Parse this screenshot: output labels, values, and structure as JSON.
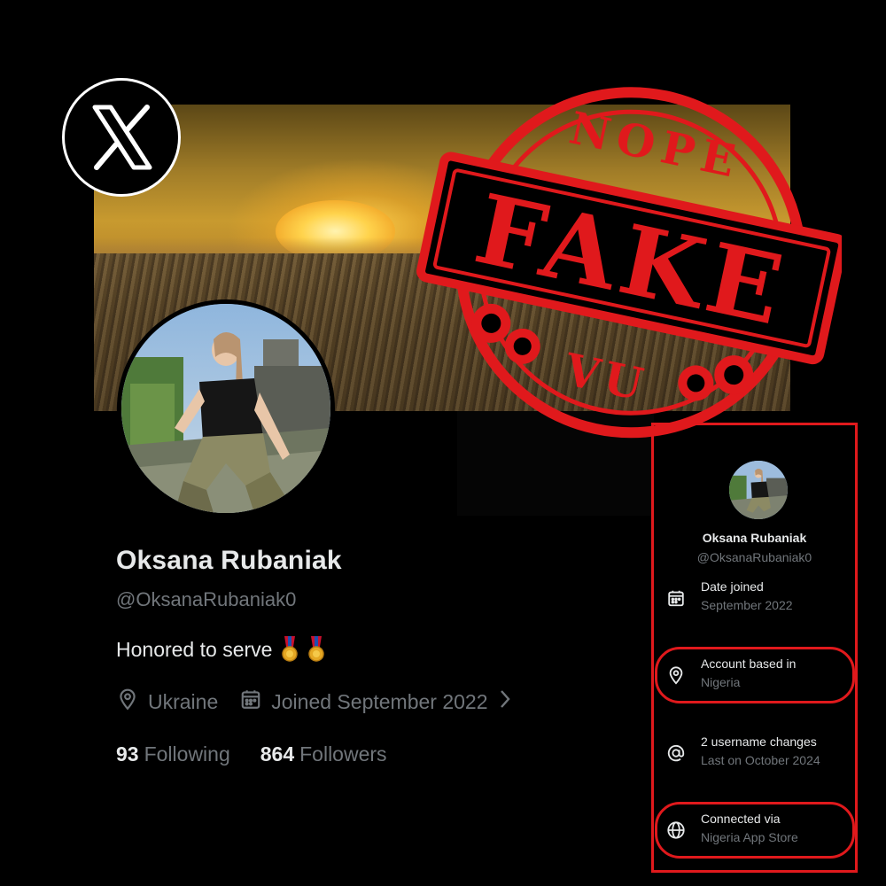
{
  "profile": {
    "name": "Oksana Rubaniak",
    "handle": "@OksanaRubaniak0",
    "bio": "Honored to serve",
    "location": "Ukraine",
    "joined": "Joined September 2022",
    "following_count": "93",
    "following_label": "Following",
    "followers_count": "864",
    "followers_label": "Followers"
  },
  "stamp": {
    "top_text": "NOPE",
    "main_text": "FAKE",
    "bottom_text": "VU",
    "color": "#e0191c"
  },
  "about_panel": {
    "name": "Oksana Rubaniak",
    "handle": "@OksanaRubaniak0",
    "rows": [
      {
        "title": "Date joined",
        "value": "September 2022",
        "icon": "calendar-icon"
      },
      {
        "title": "Account based in",
        "value": "Nigeria",
        "icon": "location-pin-icon"
      },
      {
        "title": "2 username changes",
        "value": "Last on October 2024",
        "icon": "at-sign-icon"
      },
      {
        "title": "Connected via",
        "value": "Nigeria App Store",
        "icon": "globe-icon"
      }
    ]
  },
  "colors": {
    "background": "#000000",
    "text_primary": "#e7e9ea",
    "text_secondary": "#71767b",
    "highlight": "#e0191c"
  }
}
